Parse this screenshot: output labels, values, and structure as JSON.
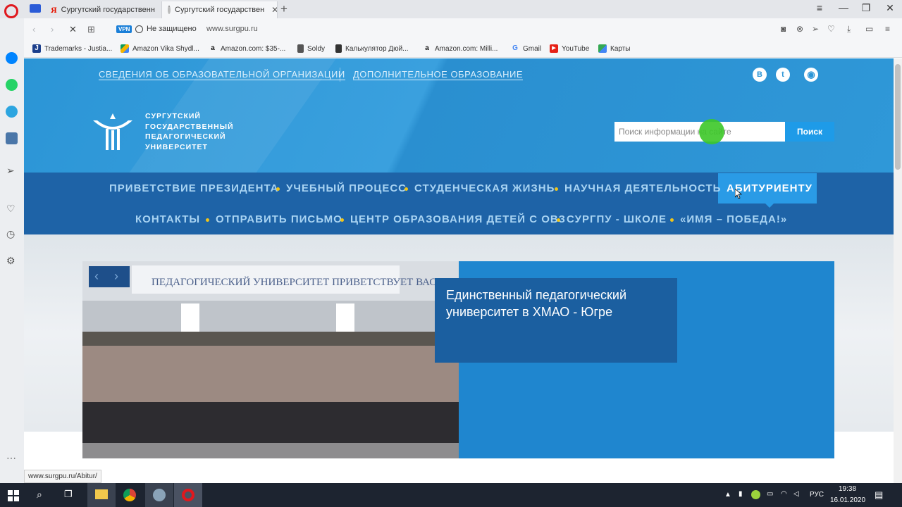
{
  "browser": {
    "tabs": [
      {
        "label": "Сургутский государственн"
      },
      {
        "label": "Сургутский государствен"
      }
    ],
    "security": "Не защищено",
    "vpn": "VPN",
    "url": "www.surgpu.ru",
    "bookmarks": [
      {
        "label": "Trademarks - Justia...",
        "icon": "J"
      },
      {
        "label": "Amazon Vika Shydl...",
        "icon": "drive"
      },
      {
        "label": "Amazon.com: $35-...",
        "icon": "a"
      },
      {
        "label": "Soldy",
        "icon": "doc"
      },
      {
        "label": "Калькулятор Дюй...",
        "icon": "calc"
      },
      {
        "label": "Amazon.com: Milli...",
        "icon": "a"
      },
      {
        "label": "Gmail",
        "icon": "G"
      },
      {
        "label": "YouTube",
        "icon": "yt"
      },
      {
        "label": "Карты",
        "icon": "maps"
      }
    ],
    "status_url": "www.surgpu.ru/Abitur/"
  },
  "site": {
    "top_links": [
      "СВЕДЕНИЯ ОБ ОБРАЗОВАТЕЛЬНОЙ ОРГАНИЗАЦИИ",
      "ДОПОЛНИТЕЛЬНОЕ ОБРАЗОВАНИЕ"
    ],
    "social": {
      "vk": "В",
      "twitter": "t"
    },
    "logo_lines": [
      "СУРГУТСКИЙ",
      "ГОСУДАРСТВЕННЫЙ",
      "ПЕДАГОГИЧЕСКИЙ",
      "УНИВЕРСИТЕТ"
    ],
    "search": {
      "placeholder": "Поиск информации на сайте",
      "button": "Поиск"
    },
    "nav_row1": [
      "ПРИВЕТСТВИЕ ПРЕЗИДЕНТА",
      "УЧЕБНЫЙ ПРОЦЕСС",
      "СТУДЕНЧЕСКАЯ ЖИЗНЬ",
      "НАУЧНАЯ ДЕЯТЕЛЬНОСТЬ",
      "АБИТУРИЕНТУ"
    ],
    "nav_row2": [
      "КОНТАКТЫ",
      "ОТПРАВИТЬ ПИСЬМО",
      "ЦЕНТР ОБРАЗОВАНИЯ ДЕТЕЙ С ОВЗ",
      "СУРГПУ - ШКОЛЕ",
      "«ИМЯ – ПОБЕДА!»"
    ],
    "photo_banner": "ПЕДАГОГИЧЕСКИЙ УНИВЕРСИТЕТ ПРИВЕТСТВУЕТ ВАС!",
    "slide_caption": "Единственный педагогический университет в ХМАО - Югре"
  },
  "taskbar": {
    "lang": "РУС",
    "time": "19:38",
    "date": "16.01.2020"
  },
  "colors": {
    "header": "#2b95d6",
    "nav": "#1e63a7",
    "nav_active": "#2a9be6",
    "accent_dot": "#f0c419",
    "caption_bg": "#1b5fa0"
  }
}
